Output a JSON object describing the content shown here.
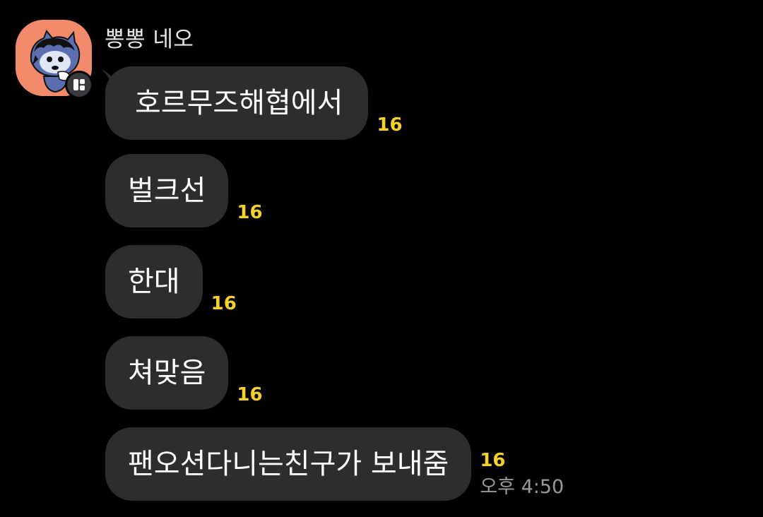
{
  "chat": {
    "sender_name": "뽕뽕 네오",
    "avatar_icon": "cartoon-cat-avatar",
    "badge_icon": "profile-badge-icon",
    "colors": {
      "background": "#000000",
      "bubble": "#2d2d2f",
      "unread": "#f5d22a",
      "time": "#9a9a9c",
      "avatar_bg": "#f28a6b"
    },
    "messages": [
      {
        "text": "호르무즈해협에서",
        "unread": "16"
      },
      {
        "text": "벌크선",
        "unread": "16"
      },
      {
        "text": "한대",
        "unread": "16"
      },
      {
        "text": "쳐맞음",
        "unread": "16"
      },
      {
        "text": "팬오션다니는친구가 보내줌",
        "unread": "16",
        "time": "오후 4:50"
      }
    ]
  }
}
